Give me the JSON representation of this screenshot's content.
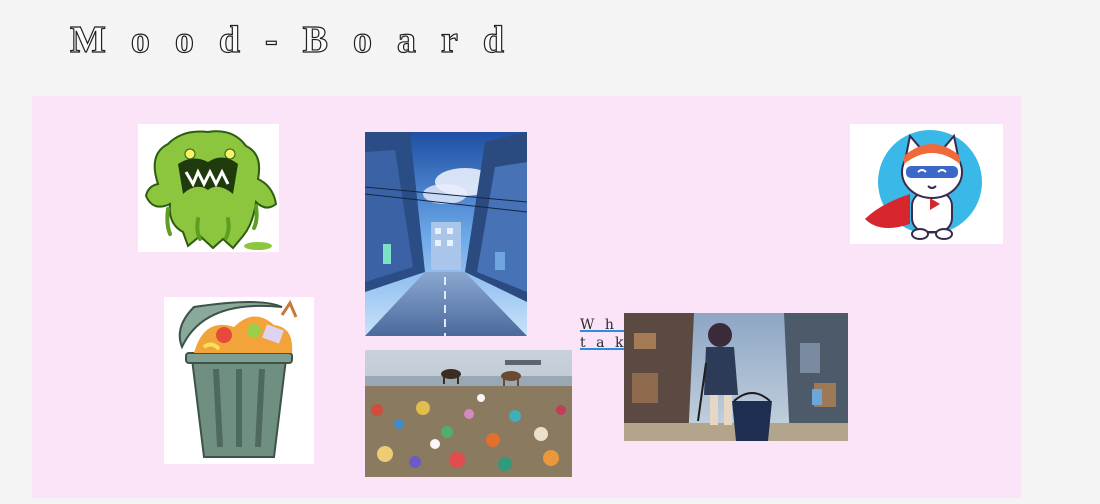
{
  "page": {
    "title": "Mood-Board"
  },
  "board": {
    "caption": "Where the game takes palce",
    "images": [
      {
        "icon": "slime-monster-image"
      },
      {
        "icon": "anime-city-street-image"
      },
      {
        "icon": "superhero-cat-image"
      },
      {
        "icon": "overflowing-trash-can-image"
      },
      {
        "icon": "garbage-dump-landscape-image"
      },
      {
        "icon": "girl-with-bucket-alley-image"
      }
    ]
  },
  "colors": {
    "board_background": "#fbe4f7",
    "page_background": "#f4f4f4",
    "link_underline": "#2a8ee0"
  }
}
